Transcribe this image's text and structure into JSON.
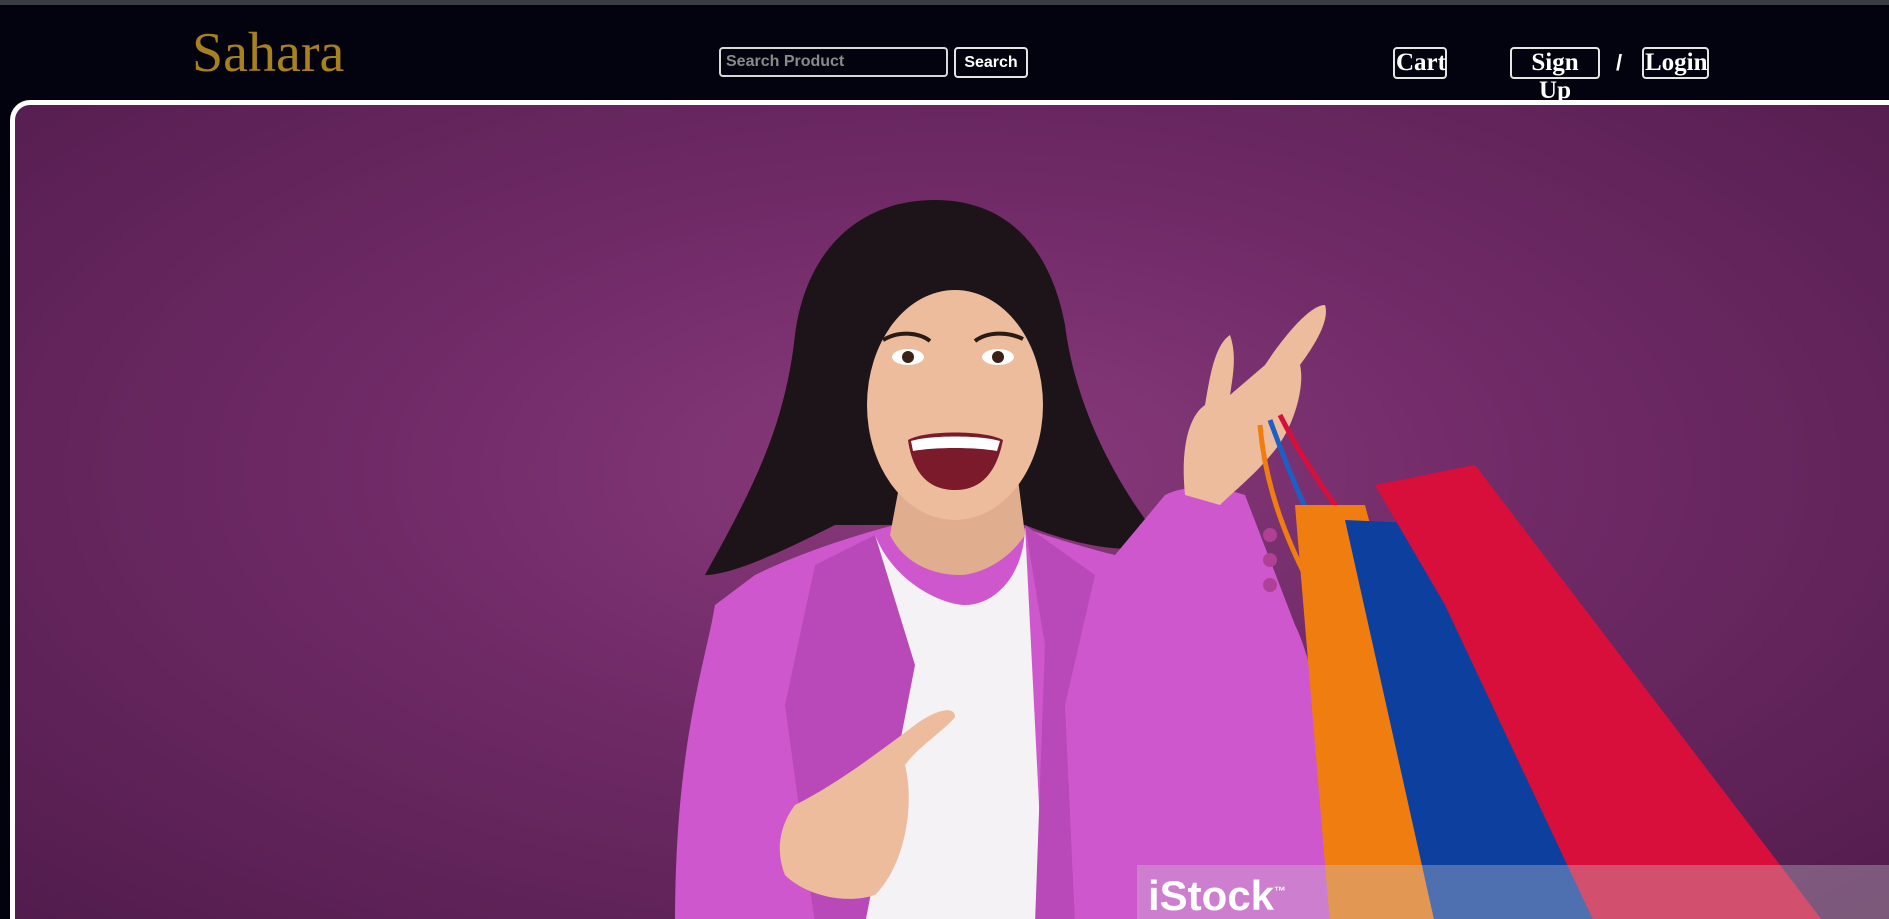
{
  "header": {
    "logo": "Sahara",
    "search": {
      "placeholder": "Search Product",
      "value": "",
      "button_label": "Search"
    },
    "cart_label": "Cart",
    "signup_label": "Sign Up",
    "separator": "/",
    "login_label": "Login"
  },
  "hero": {
    "watermark": "iStock",
    "watermark_tm": "™"
  },
  "colors": {
    "page_background": "#02020f",
    "logo": "#a8801e",
    "hero_background": "#7a2e70",
    "blazer": "#d25bcf",
    "bag_orange": "#f07d10",
    "bag_blue": "#0d3f9e",
    "bag_red": "#d80f3a"
  }
}
